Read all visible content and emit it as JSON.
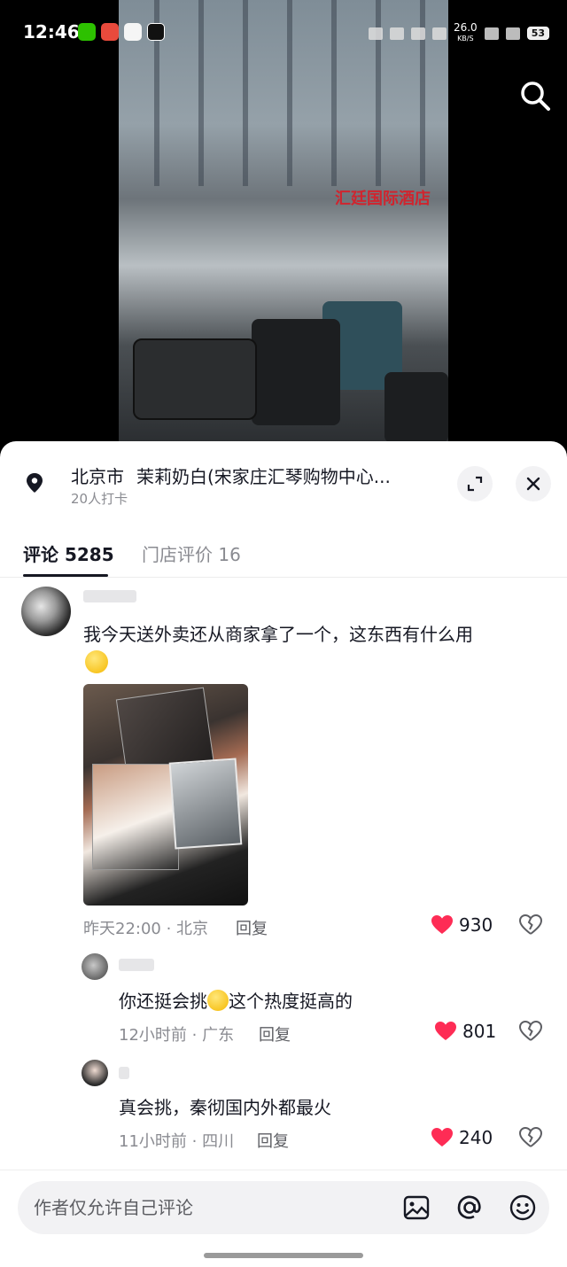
{
  "status_bar": {
    "time": "12:46",
    "speed": "26.0",
    "speed_unit": "KB/S",
    "battery": "53"
  },
  "video": {
    "hotel_sign": "汇廷国际酒店"
  },
  "location": {
    "city": "北京市",
    "name": "茉莉奶白(宋家庄汇琴购物中心...",
    "checkins": "20人打卡"
  },
  "tabs": [
    {
      "label": "评论 5285"
    },
    {
      "label": "门店评价 16"
    }
  ],
  "comments": [
    {
      "text": "我今天送外卖还从商家拿了一个，这东西有什么用",
      "emoji": "smile-emoji",
      "time": "昨天22:00 · 北京",
      "reply_label": "回复",
      "likes": "930",
      "replies": [
        {
          "text_before": "你还挺会挑",
          "emoji": "crying-laugh-emoji",
          "text_after": "这个热度挺高的",
          "time": "12小时前 · 广东",
          "reply_label": "回复",
          "likes": "801"
        },
        {
          "text": "真会挑，秦彻国内外都最火",
          "time": "11小时前 · 四川",
          "reply_label": "回复",
          "likes": "240"
        }
      ]
    }
  ],
  "input": {
    "placeholder": "作者仅允许自己评论"
  },
  "colors": {
    "like": "#fe2c55",
    "text": "#161823",
    "muted": "#8a8b91",
    "hotel_sign": "#d0242e"
  }
}
